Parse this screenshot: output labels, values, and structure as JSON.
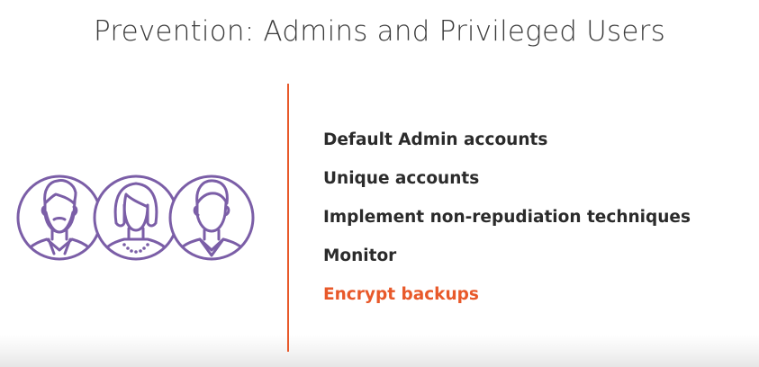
{
  "slide": {
    "title": "Prevention: Admins and Privileged Users",
    "accent_color": "#e8592a",
    "icon_color": "#7b5ea7",
    "icon_name": "group-of-users-icon",
    "bullets": [
      {
        "text": "Default Admin accounts",
        "highlighted": false
      },
      {
        "text": "Unique accounts",
        "highlighted": false
      },
      {
        "text": "Implement non-repudiation techniques",
        "highlighted": false
      },
      {
        "text": "Monitor",
        "highlighted": false
      },
      {
        "text": "Encrypt backups",
        "highlighted": true
      }
    ]
  }
}
